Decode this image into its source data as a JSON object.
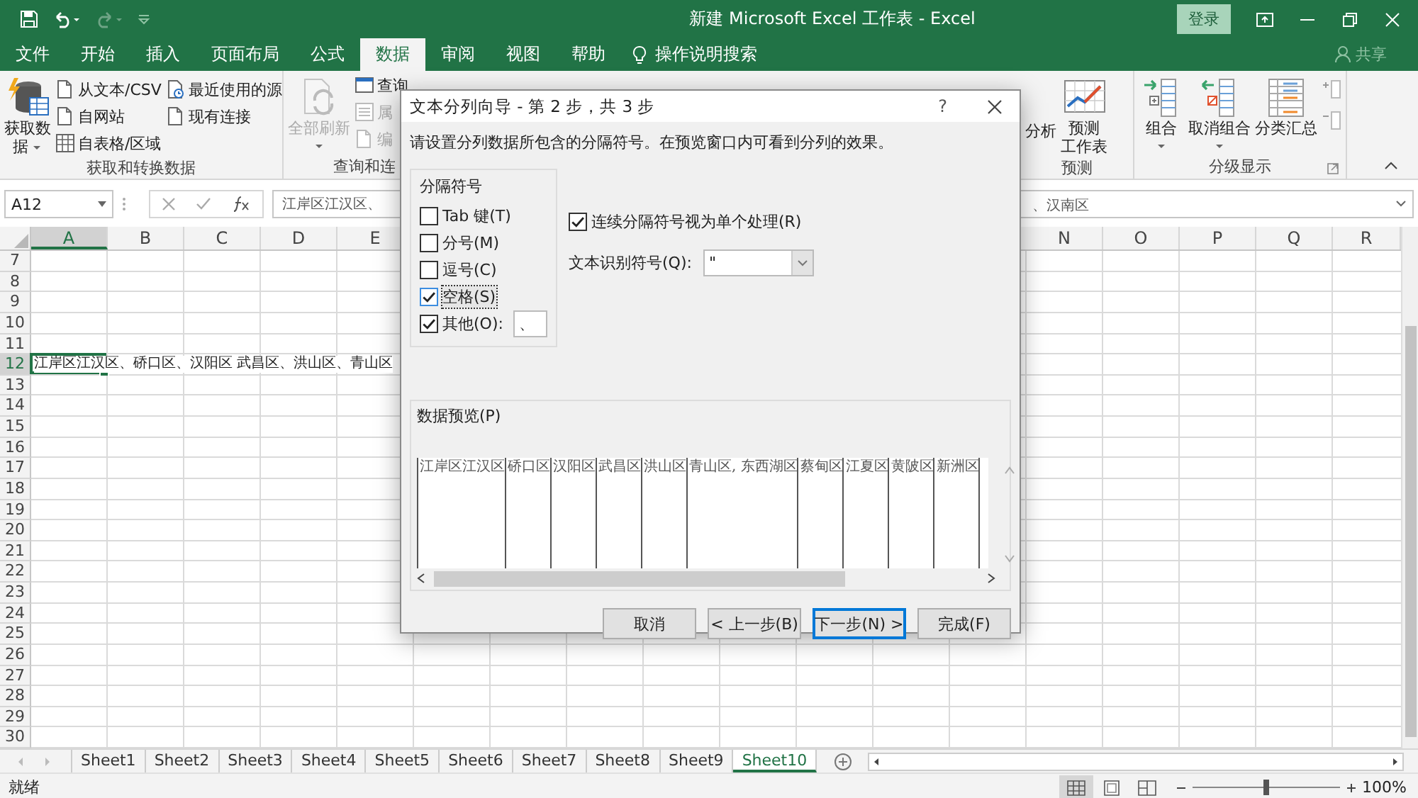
{
  "window": {
    "title": "新建 Microsoft Excel 工作表 - Excel",
    "sign_in": "登录"
  },
  "ribbon_tabs": [
    {
      "label": "文件",
      "selected": false
    },
    {
      "label": "开始",
      "selected": false
    },
    {
      "label": "插入",
      "selected": false
    },
    {
      "label": "页面布局",
      "selected": false
    },
    {
      "label": "公式",
      "selected": false
    },
    {
      "label": "数据",
      "selected": true
    },
    {
      "label": "审阅",
      "selected": false
    },
    {
      "label": "视图",
      "selected": false
    },
    {
      "label": "帮助",
      "selected": false
    }
  ],
  "tell_me": "操作说明搜索",
  "share": "共享",
  "ribbon_groups": [
    {
      "label": "获取和转换数据",
      "launcher": false,
      "columns": [
        {
          "kind": "large",
          "lines": [
            "获取数",
            "据"
          ],
          "dropdown": true,
          "disabled": false
        },
        {
          "kind": "small",
          "items": [
            {
              "label": "从文本/CSV",
              "disabled": false
            },
            {
              "label": "自网站",
              "disabled": false
            },
            {
              "label": "自表格/区域",
              "disabled": false
            }
          ]
        },
        {
          "kind": "small",
          "items": [
            {
              "label": "最近使用的源",
              "disabled": false
            },
            {
              "label": "现有连接",
              "disabled": false
            }
          ]
        }
      ]
    },
    {
      "label": "查询和连",
      "launcher": false,
      "columns": [
        {
          "kind": "large",
          "lines": [
            "全部刷新"
          ],
          "dropdown": true,
          "disabled": true
        },
        {
          "kind": "small",
          "items": [
            {
              "label": "查询",
              "disabled": false
            },
            {
              "label": "属",
              "disabled": true
            },
            {
              "label": "编",
              "disabled": true
            }
          ]
        }
      ]
    },
    {
      "label": "预测",
      "launcher": false,
      "columns": [
        {
          "kind": "label",
          "lines": [
            "分析"
          ]
        },
        {
          "kind": "large",
          "lines": [
            "预测",
            "工作表"
          ],
          "dropdown": false,
          "disabled": false
        }
      ]
    },
    {
      "label": "分级显示",
      "launcher": true,
      "columns": [
        {
          "kind": "large",
          "lines": [
            "组合"
          ],
          "dropdown": true,
          "disabled": false
        },
        {
          "kind": "large",
          "lines": [
            "取消组合"
          ],
          "dropdown": true,
          "disabled": false
        },
        {
          "kind": "large",
          "lines": [
            "分类汇总"
          ],
          "dropdown": false,
          "disabled": false
        },
        {
          "kind": "outline_icons"
        }
      ]
    }
  ],
  "name_box": "A12",
  "formula": {
    "visible_start": "江岸区江汉区、",
    "visible_end": "、汉南区"
  },
  "sheet": {
    "columns_left": [
      {
        "label": "A",
        "selected": true
      },
      {
        "label": "B",
        "selected": false
      },
      {
        "label": "C",
        "selected": false
      },
      {
        "label": "D",
        "selected": false
      },
      {
        "label": "E",
        "selected": false
      }
    ],
    "columns_right": [
      {
        "label": "N",
        "selected": false
      },
      {
        "label": "O",
        "selected": false
      },
      {
        "label": "P",
        "selected": false
      },
      {
        "label": "Q",
        "selected": false
      },
      {
        "label": "R",
        "selected": false
      }
    ],
    "rows": [
      {
        "number": "7",
        "selected": false
      },
      {
        "number": "8",
        "selected": false
      },
      {
        "number": "9",
        "selected": false
      },
      {
        "number": "10",
        "selected": false
      },
      {
        "number": "11",
        "selected": false
      },
      {
        "number": "12",
        "selected": true,
        "text": "江岸区江汉区、硚口区、汉阳区 武昌区、洪山区、青山区"
      },
      {
        "number": "13",
        "selected": false
      },
      {
        "number": "14",
        "selected": false
      },
      {
        "number": "15",
        "selected": false
      },
      {
        "number": "16",
        "selected": false
      },
      {
        "number": "17",
        "selected": false
      },
      {
        "number": "18",
        "selected": false
      },
      {
        "number": "19",
        "selected": false
      },
      {
        "number": "20",
        "selected": false
      },
      {
        "number": "21",
        "selected": false
      },
      {
        "number": "22",
        "selected": false
      },
      {
        "number": "23",
        "selected": false
      },
      {
        "number": "24",
        "selected": false
      },
      {
        "number": "25",
        "selected": false
      },
      {
        "number": "26",
        "selected": false
      },
      {
        "number": "27",
        "selected": false
      },
      {
        "number": "28",
        "selected": false
      },
      {
        "number": "29",
        "selected": false
      },
      {
        "number": "30",
        "selected": false
      }
    ]
  },
  "sheet_tabs": [
    {
      "label": "Sheet1",
      "selected": false
    },
    {
      "label": "Sheet2",
      "selected": false
    },
    {
      "label": "Sheet3",
      "selected": false
    },
    {
      "label": "Sheet4",
      "selected": false
    },
    {
      "label": "Sheet5",
      "selected": false
    },
    {
      "label": "Sheet6",
      "selected": false
    },
    {
      "label": "Sheet7",
      "selected": false
    },
    {
      "label": "Sheet8",
      "selected": false
    },
    {
      "label": "Sheet9",
      "selected": false
    },
    {
      "label": "Sheet10",
      "selected": true
    }
  ],
  "status": "就绪",
  "views": [
    {
      "selected": true
    },
    {
      "selected": false
    },
    {
      "selected": false
    }
  ],
  "zoom": {
    "label": "100%",
    "level": 0.5
  },
  "dialog": {
    "title": "文本分列向导 - 第 2 步，共 3 步",
    "help": "?",
    "instruction": "请设置分列数据所包含的分隔符号。在预览窗口内可看到分列的效果。",
    "delimiters": {
      "legend": "分隔符号",
      "options": [
        {
          "label": "Tab 键(T)",
          "checked": false,
          "focused": false
        },
        {
          "label": "分号(M)",
          "checked": false,
          "focused": false
        },
        {
          "label": "逗号(C)",
          "checked": false,
          "focused": false
        },
        {
          "label": "空格(S)",
          "checked": true,
          "focused": true
        },
        {
          "label": "其他(O):",
          "checked": true,
          "focused": false,
          "value": "、"
        }
      ]
    },
    "treat_consecutive": {
      "label": "连续分隔符号视为单个处理(R)",
      "checked": true
    },
    "text_qualifier": {
      "label": "文本识别符号(Q):",
      "value": "\""
    },
    "preview": {
      "label": "数据预览(P)",
      "columns": [
        "江岸区江汉区",
        "硚口区",
        "汉阳区",
        "武昌区",
        "洪山区",
        "青山区, 东西湖区",
        "蔡甸区",
        "江夏区",
        "黄陂区",
        "新洲区"
      ]
    },
    "buttons": [
      {
        "label": "取消",
        "default": false
      },
      {
        "label": "< 上一步(B)",
        "default": false
      },
      {
        "label": "下一步(N) >",
        "default": true
      },
      {
        "label": "完成(F)",
        "default": false
      }
    ]
  }
}
